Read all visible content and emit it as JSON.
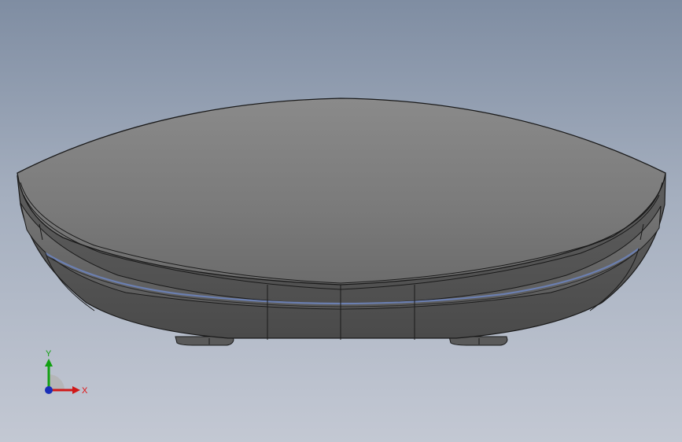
{
  "viewport": {
    "background_top": "#7f8da2",
    "background_bottom": "#c3c8d3",
    "model": {
      "kind": "3d-mouse-shell-side-view",
      "body_color": "#6e6e6e",
      "top_color": "#7a7a7a",
      "edge_color": "#1a1a1a",
      "accent_line_color": "#6b7fb0"
    }
  },
  "triad": {
    "y_label": "Y",
    "x_label": "X",
    "y_color": "#11a011",
    "x_color": "#d01818",
    "z_color": "#1a2fb8"
  }
}
